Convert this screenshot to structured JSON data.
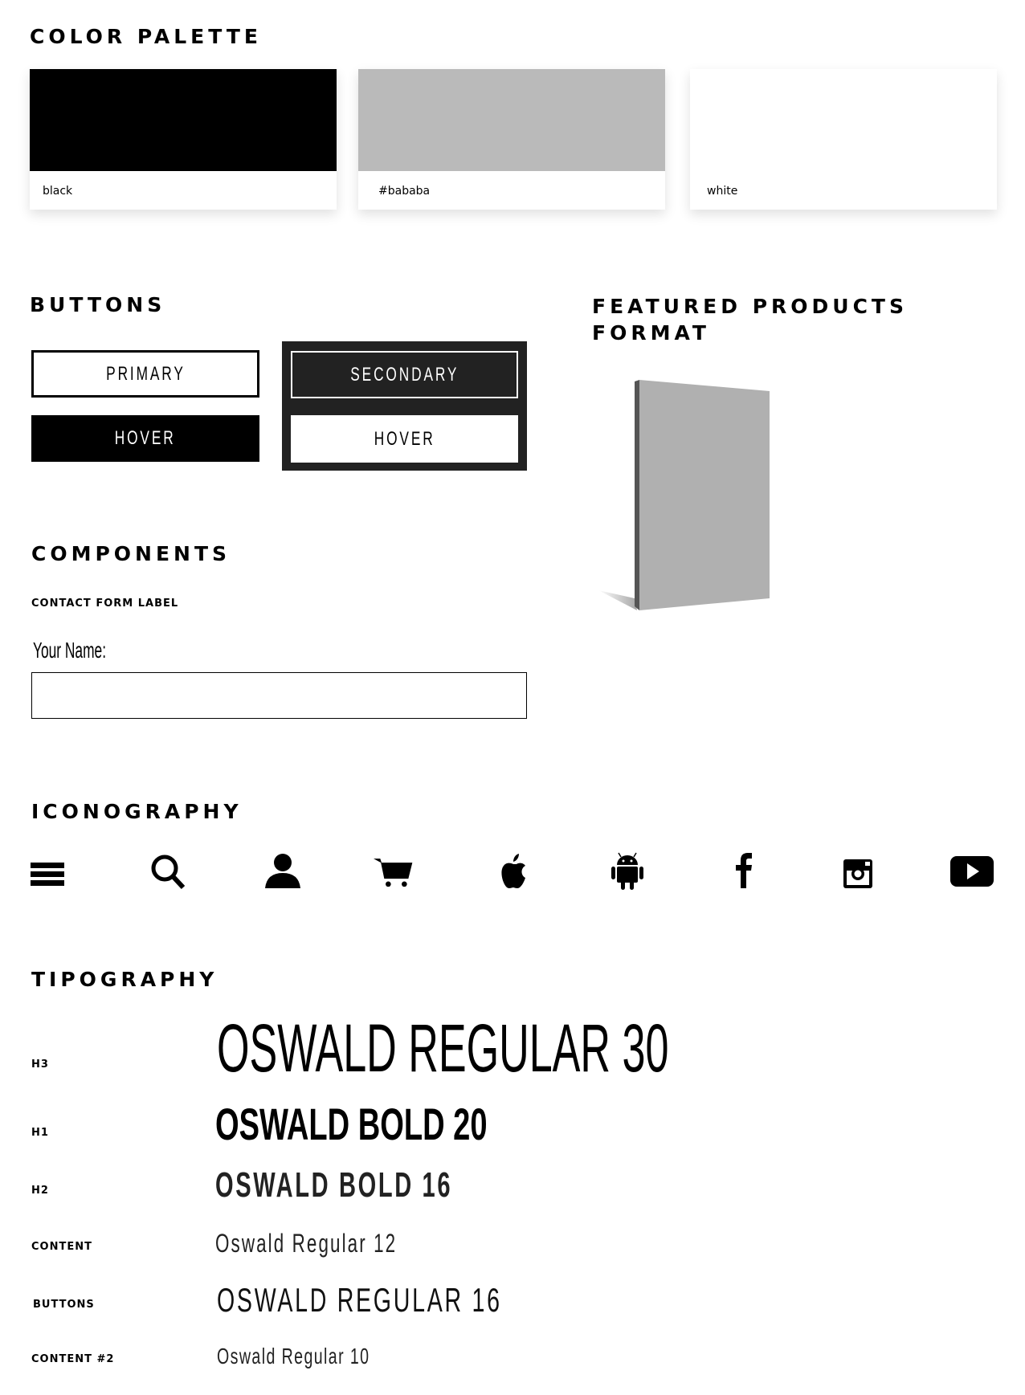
{
  "color_palette": {
    "title": "COLOR PALETTE",
    "swatches": [
      {
        "label": "black",
        "color": "#000000"
      },
      {
        "label": "#bababa",
        "color": "#bababa"
      },
      {
        "label": "white",
        "color": "#ffffff"
      }
    ]
  },
  "buttons": {
    "title": "BUTTONS",
    "primary": "PRIMARY",
    "primary_hover": "HOVER",
    "secondary": "SECONDARY",
    "secondary_hover": "HOVER"
  },
  "featured": {
    "title_line1": "FEATURED PRODUCTS",
    "title_line2": "FORMAT"
  },
  "components": {
    "title": "COMPONENTS",
    "form_label_caption": "CONTACT FORM LABEL",
    "name_label": "Your Name:",
    "name_value": ""
  },
  "iconography": {
    "title": "ICONOGRAPHY",
    "icons": [
      "menu-icon",
      "search-icon",
      "user-icon",
      "cart-icon",
      "apple-icon",
      "android-icon",
      "facebook-icon",
      "instagram-icon",
      "youtube-icon"
    ]
  },
  "typography": {
    "title": "TIPOGRAPHY",
    "rows": [
      {
        "label": "H3",
        "sample": "OSWALD REGULAR 30"
      },
      {
        "label": "H1",
        "sample": "OSWALD BOLD 20"
      },
      {
        "label": "H2",
        "sample": "OSWALD BOLD 16"
      },
      {
        "label": "CONTENT",
        "sample": "Oswald Regular 12"
      },
      {
        "label": "BUTTONS",
        "sample": "OSWALD REGULAR 16"
      },
      {
        "label": "CONTENT #2",
        "sample": "Oswald Regular 10"
      }
    ]
  }
}
